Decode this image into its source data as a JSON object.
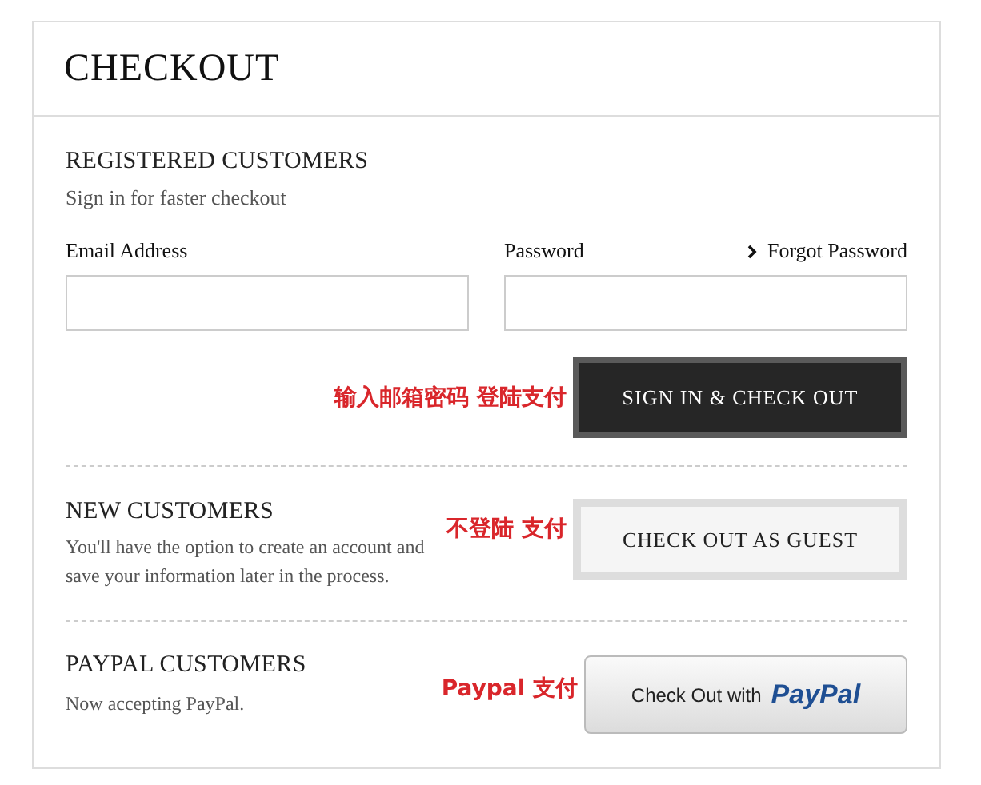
{
  "title": "CHECKOUT",
  "registered": {
    "heading": "REGISTERED CUSTOMERS",
    "subtitle": "Sign in for faster checkout",
    "email_label": "Email Address",
    "password_label": "Password",
    "forgot_link": "Forgot Password",
    "annotation": "输入邮箱密码 登陆支付",
    "button": "SIGN IN & CHECK OUT"
  },
  "new": {
    "heading": "NEW CUSTOMERS",
    "description": "You'll have the option to create an account and save your information later in the process.",
    "annotation": "不登陆 支付",
    "button": "CHECK OUT AS GUEST"
  },
  "paypal": {
    "heading": "PAYPAL CUSTOMERS",
    "description": "Now accepting PayPal.",
    "annotation": "Paypal 支付",
    "button_text": "Check Out with",
    "button_logo": "PayPal"
  }
}
